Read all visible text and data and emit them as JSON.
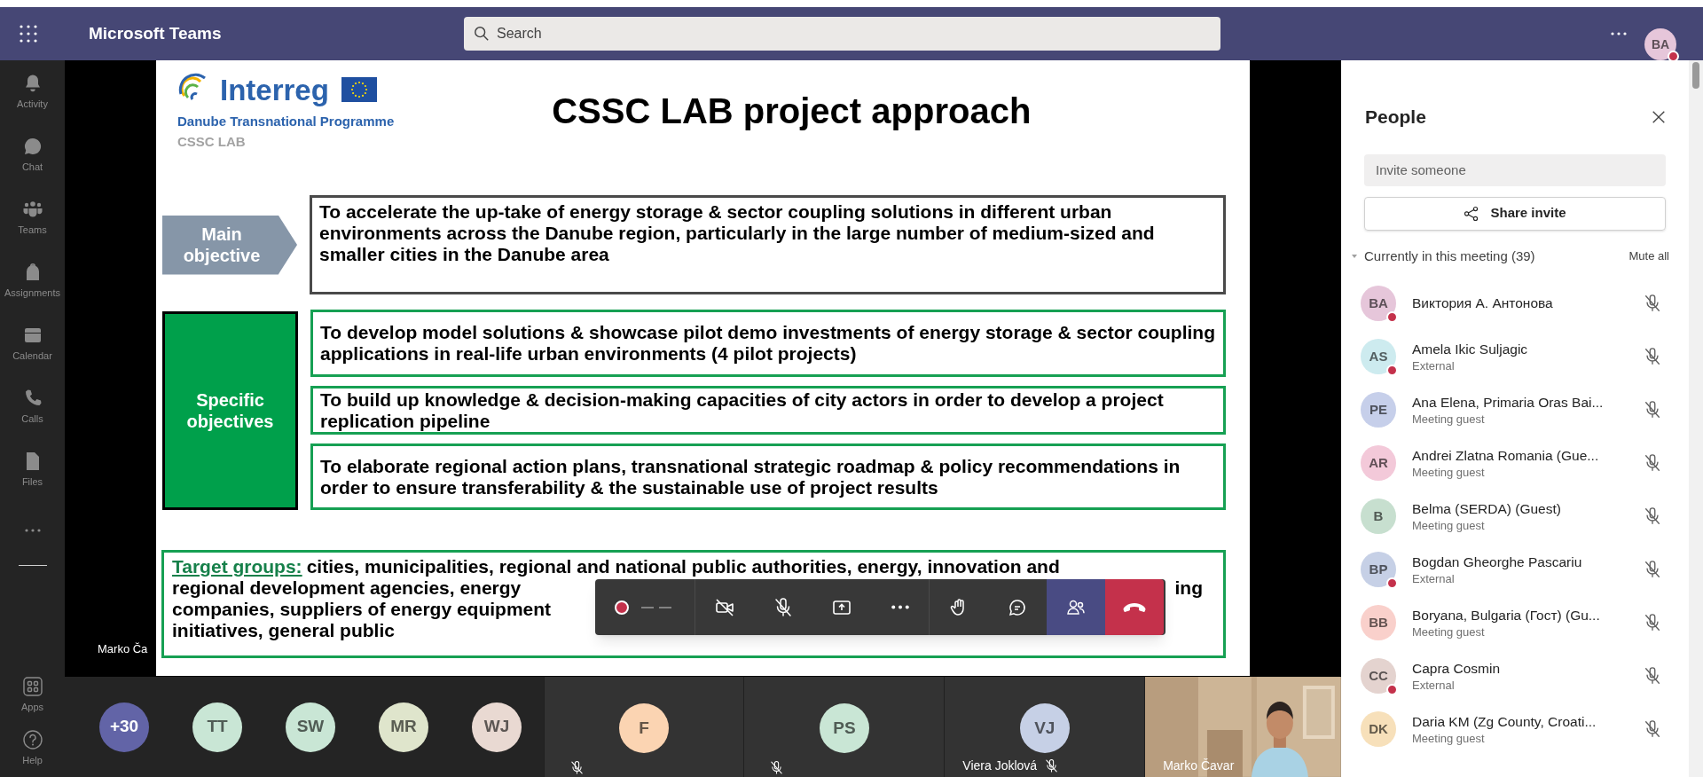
{
  "app_bar": {
    "title": "Microsoft Teams",
    "search": {
      "placeholder": "Search"
    },
    "user": {
      "initials": "BA",
      "color": "#e6c6da",
      "busy": true
    }
  },
  "rail": {
    "items": [
      {
        "kind": "activity",
        "label": "Activity"
      },
      {
        "kind": "chat",
        "label": "Chat"
      },
      {
        "kind": "teams",
        "label": "Teams"
      },
      {
        "kind": "assignments",
        "label": "Assignments"
      },
      {
        "kind": "calendar",
        "label": "Calendar"
      },
      {
        "kind": "calls",
        "label": "Calls"
      },
      {
        "kind": "files",
        "label": "Files"
      }
    ],
    "bottom": [
      {
        "kind": "apps",
        "label": "Apps"
      },
      {
        "kind": "help",
        "label": "Help"
      }
    ]
  },
  "stage": {
    "presenter_label": "Marko Ča",
    "slide": {
      "logo": {
        "wordmark": "Interreg",
        "programme": "Danube Transnational Programme",
        "project": "CSSC LAB"
      },
      "title": "CSSC LAB project approach",
      "main_objective": {
        "label": "Main objective",
        "text": "To accelerate the up-take of energy storage & sector coupling solutions in different urban environments across the Danube region, particularly in the large number of medium-sized and smaller cities in the Danube area"
      },
      "specific_objectives": {
        "label": "Specific objectives",
        "items": [
          "To develop model solutions & showcase pilot demo investments of energy storage & sector coupling applications in real-life urban environments (4 pilot projects)",
          "To build up knowledge & decision-making capacities of city actors in order to develop a project replication pipeline",
          "To elaborate regional action plans, transnational strategic roadmap & policy recommendations in order to ensure transferability & the sustainable use of project results"
        ]
      },
      "target_groups": {
        "label": "Target groups:",
        "lines": [
          "cities, municipalities, regional and national public authorities, energy, innovation and",
          "regional development agencies, energy",
          "companies, suppliers of energy equipment",
          "initiatives, general public"
        ],
        "line_end": "ing"
      }
    },
    "controls": [
      {
        "kind": "record",
        "selected": false
      },
      {
        "kind": "camera_off",
        "selected": false
      },
      {
        "kind": "mic_off",
        "selected": false
      },
      {
        "kind": "share",
        "selected": false
      },
      {
        "kind": "more",
        "selected": false
      },
      {
        "kind": "hand",
        "selected": false
      },
      {
        "kind": "chat",
        "selected": false
      },
      {
        "kind": "people",
        "selected": true
      },
      {
        "kind": "leave",
        "selected": false
      }
    ]
  },
  "strip": {
    "avatars": [
      {
        "initials": "+30",
        "color": "#6264a7"
      },
      {
        "initials": "TT",
        "color": "#c9e6d5"
      },
      {
        "initials": "SW",
        "color": "#c9e6d5"
      },
      {
        "initials": "MR",
        "color": "#dfe5cc"
      },
      {
        "initials": "WJ",
        "color": "#e9d9d2"
      }
    ],
    "tiles": [
      {
        "kind": "avatar",
        "initials": "F",
        "color": "#fbd4b2",
        "muted": true
      },
      {
        "kind": "avatar",
        "initials": "PS",
        "color": "#c9e6d5",
        "muted": true
      },
      {
        "kind": "avatar",
        "initials": "VJ",
        "color": "#c6d0e6",
        "name": "Viera Joklová",
        "muted": true
      },
      {
        "kind": "video",
        "name": "Marko Čavar",
        "muted": false
      }
    ]
  },
  "people": {
    "title": "People",
    "invite": {
      "placeholder": "Invite someone"
    },
    "share_button": "Share invite",
    "section": {
      "label": "Currently in this meeting (39)",
      "expanded": true,
      "action": "Mute all"
    },
    "participants": [
      {
        "initials": "BA",
        "color": "#e6c6da",
        "busy": true,
        "name": "Виктория А. Антонова",
        "muted": true
      },
      {
        "initials": "AS",
        "color": "#cdebef",
        "busy": true,
        "name": "Amela Ikic Suljagic",
        "subtitle": "External",
        "muted": true
      },
      {
        "initials": "PE",
        "color": "#c6cfea",
        "busy": false,
        "name": "Ana Elena, Primaria Oras Bai...",
        "subtitle": "Meeting guest",
        "muted": true
      },
      {
        "initials": "AR",
        "color": "#f3c9d9",
        "busy": false,
        "name": "Andrei Zlatna Romania (Gue...",
        "subtitle": "Meeting guest",
        "muted": true
      },
      {
        "initials": "B",
        "color": "#c7dfcf",
        "busy": false,
        "name": "Belma (SERDA) (Guest)",
        "subtitle": "Meeting guest",
        "muted": true
      },
      {
        "initials": "BP",
        "color": "#c6d0e6",
        "busy": true,
        "name": "Bogdan Gheorghe Pascariu",
        "subtitle": "External",
        "muted": true
      },
      {
        "initials": "BB",
        "color": "#f9d0cb",
        "busy": false,
        "name": "Boryana, Bulgaria (Гост) (Gu...",
        "subtitle": "Meeting guest",
        "muted": true
      },
      {
        "initials": "CC",
        "color": "#e4d3cf",
        "busy": true,
        "name": "Capra Cosmin",
        "subtitle": "External",
        "muted": true
      },
      {
        "initials": "DK",
        "color": "#f7e0ba",
        "busy": false,
        "name": "Daria KM (Zg County, Croati...",
        "subtitle": "Meeting guest",
        "muted": true
      }
    ]
  }
}
